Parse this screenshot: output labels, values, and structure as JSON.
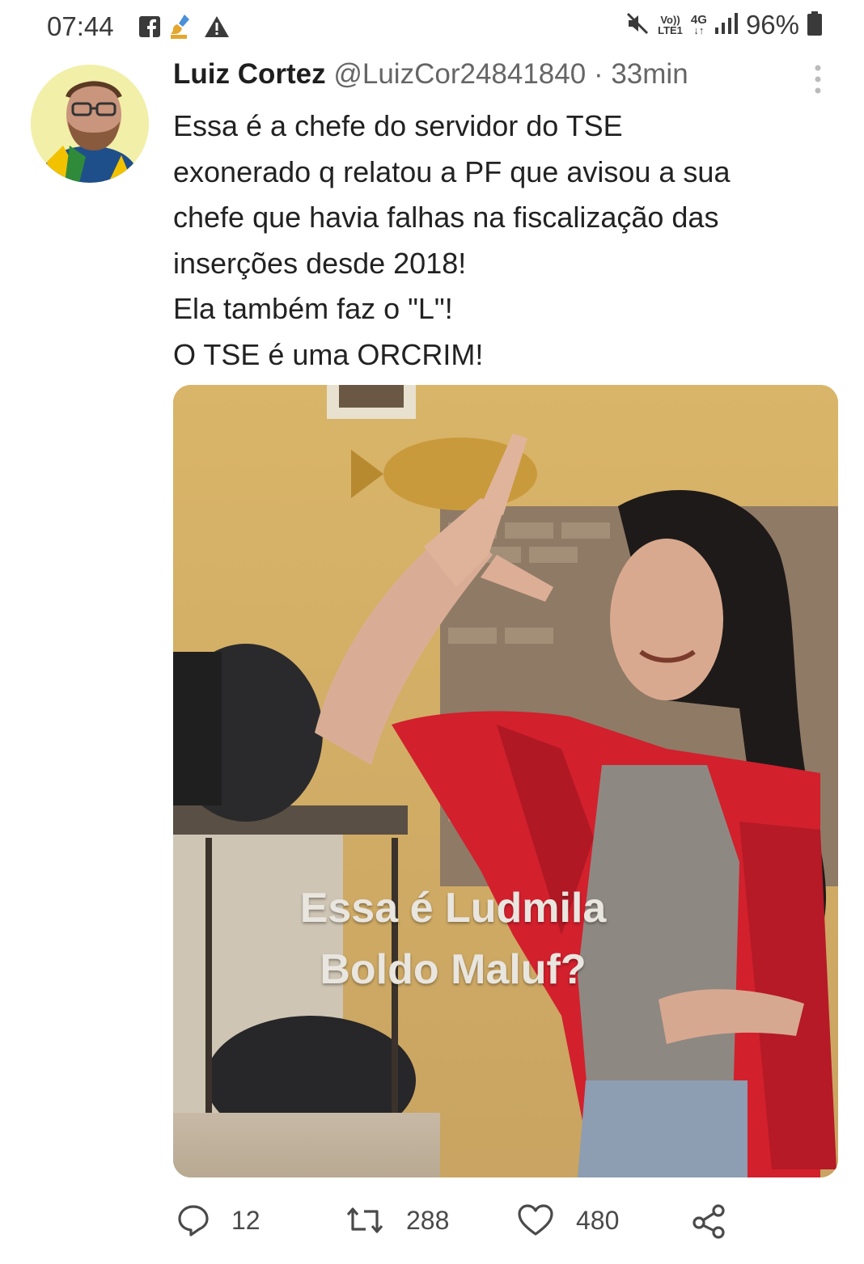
{
  "status_bar": {
    "time": "07:44",
    "left_icons": [
      "facebook-icon",
      "paint-brush-icon",
      "warning-icon"
    ],
    "right_icons": [
      "mute-icon",
      "volte-icon",
      "4g-icon",
      "signal-icon",
      "battery-icon"
    ],
    "volte_top": "Vo))",
    "volte_bottom": "LTE1",
    "network_top": "4G",
    "network_bottom": "↓↑",
    "battery": "96%"
  },
  "tweet": {
    "author_name": "Luiz Cortez",
    "author_handle": "@LuizCor24841840",
    "separator": "·",
    "timestamp": "33min",
    "text_lines": [
      "Essa é a chefe do servidor do TSE",
      "exonerado q relatou a PF que avisou a sua",
      "chefe que havia falhas na fiscalização das",
      "inserções desde 2018!",
      "Ela também faz o \"L\"!",
      "O TSE é uma ORCRIM!"
    ],
    "media": {
      "caption_line1": "Essa é Ludmila",
      "caption_line2": "Boldo Maluf?"
    },
    "actions": {
      "replies": "12",
      "retweets": "288",
      "likes": "480"
    }
  },
  "colors": {
    "text": "#222222",
    "muted": "#666666",
    "icon": "#4a4a4a",
    "photo_red": "#d2202d"
  }
}
